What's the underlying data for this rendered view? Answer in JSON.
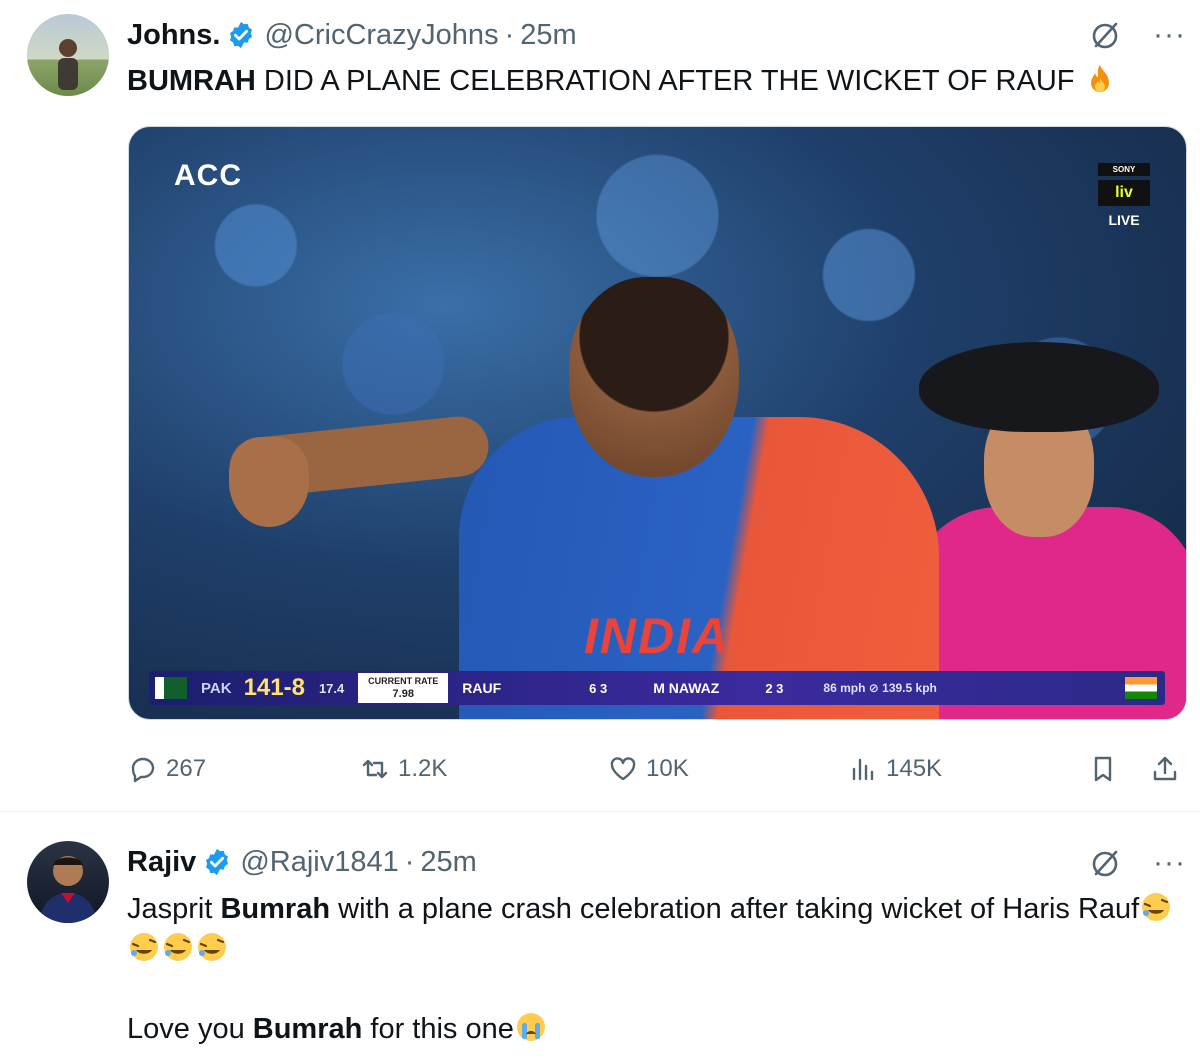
{
  "tweets": [
    {
      "author_name": "Johns.",
      "handle": "@CricCrazyJohns",
      "separator": "·",
      "time": "25m",
      "text_bold": "BUMRAH",
      "text_rest": " DID A PLANE CELEBRATION AFTER THE WICKET OF RAUF",
      "text_emoji": "fire",
      "media": {
        "broadcaster_logo": "ACC",
        "channel_logo_top": "SONY",
        "channel_logo_mid": "liv",
        "channel_logo_live": "LIVE",
        "jersey_text": "INDIA",
        "scoreboard": {
          "team": "PAK",
          "score": "141-8",
          "overs": "17.4",
          "rate_label": "CURRENT RATE",
          "rate_value": "7.98",
          "batter1": "RAUF",
          "batter1_runs": "6 3",
          "batter2": "M NAWAZ",
          "batter2_runs": "2 3",
          "speed": "86 mph ⊘ 139.5 kph"
        }
      },
      "stats": {
        "replies": "267",
        "reposts": "1.2K",
        "likes": "10K",
        "views": "145K"
      }
    },
    {
      "author_name": "Rajiv",
      "handle": "@Rajiv1841",
      "separator": "·",
      "time": "25m",
      "line1_a": "Jasprit ",
      "line1_bold": "Bumrah",
      "line1_b": " with a plane crash celebration after taking wicket of Haris Rauf",
      "line2_a": "Love you ",
      "line2_bold": "Bumrah",
      "line2_b": " for this one"
    }
  ],
  "colors": {
    "verified": "#1d9bf0",
    "secondary_text": "#536471",
    "primary_text": "#0f1419"
  }
}
